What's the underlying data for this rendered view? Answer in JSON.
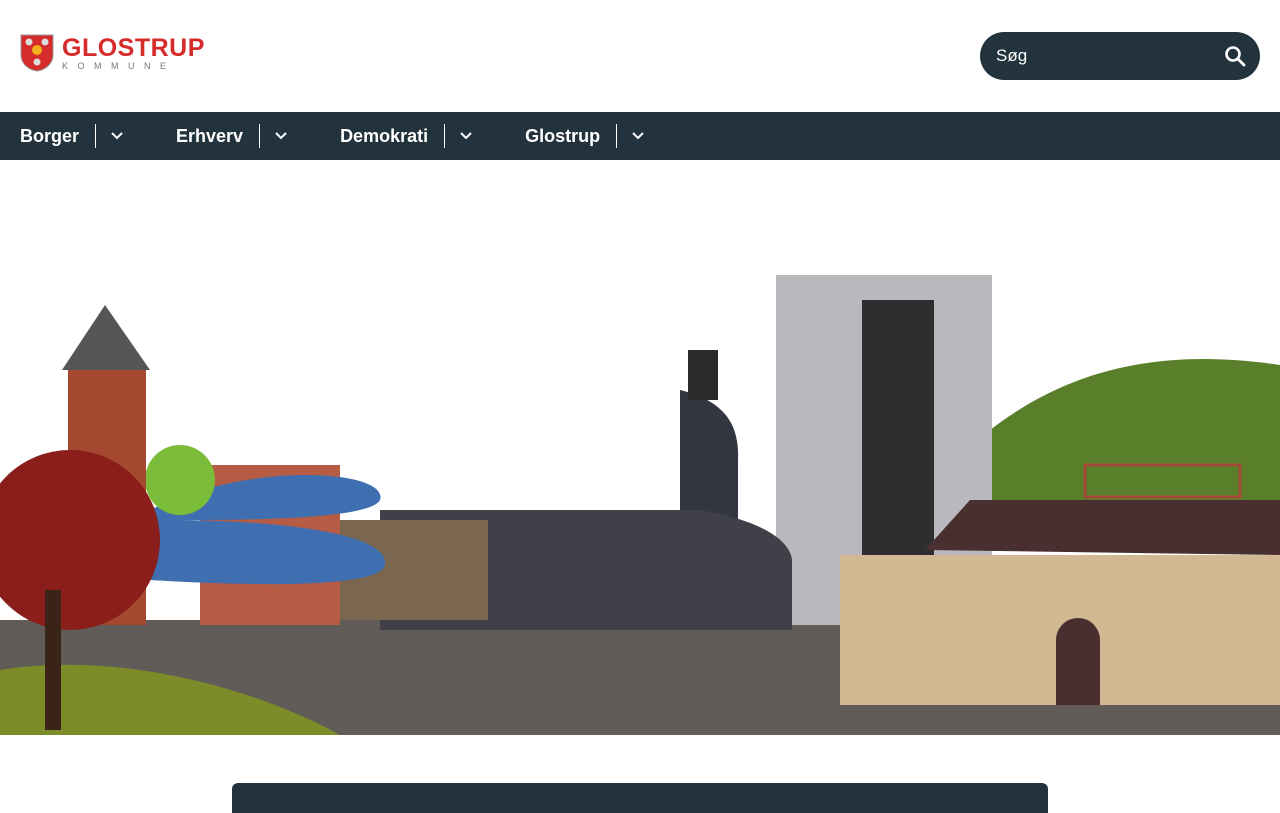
{
  "logo": {
    "name": "GLOSTRUP",
    "subtitle": "KOMMUNE"
  },
  "search": {
    "placeholder": "Søg",
    "icon": "search-icon"
  },
  "nav": {
    "items": [
      {
        "label": "Borger"
      },
      {
        "label": "Erhverv"
      },
      {
        "label": "Demokrati"
      },
      {
        "label": "Glostrup"
      }
    ]
  },
  "colors": {
    "primary": "#22333e",
    "brand_red": "#d52b2b"
  }
}
